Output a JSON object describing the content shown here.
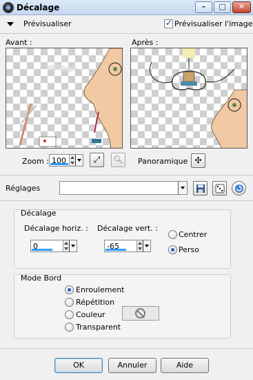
{
  "window": {
    "title": "Décalage"
  },
  "preview": {
    "toggle_label": "Prévisualiser",
    "live_label": "Prévisualiser l'image",
    "live_checked": true,
    "before_label": "Avant :",
    "after_label": "Après :"
  },
  "zoom": {
    "label": "Zoom :",
    "value": "100",
    "pan_label": "Panoramique :"
  },
  "presets": {
    "label": "Réglages",
    "value": ""
  },
  "offset": {
    "group_label": "Décalage",
    "h_label": "Décalage horiz. :",
    "h_value": "0",
    "v_label": "Décalage vert. :",
    "v_value": "-65",
    "center_label": "Centrer",
    "custom_label": "Perso",
    "selected": "custom"
  },
  "edge_mode": {
    "group_label": "Mode Bord",
    "options": [
      "Enroulement",
      "Répétition",
      "Couleur",
      "Transparent"
    ],
    "selected": "Enroulement"
  },
  "buttons": {
    "ok": "OK",
    "cancel": "Annuler",
    "help": "Aide"
  },
  "colors": {
    "accent": "#3399ff",
    "titlebar": "#c4d8f0",
    "close": "#c4472f"
  },
  "icons": {
    "app": "camera-lens-icon",
    "fit": "fit-window-icon",
    "zoom_to": "magnifier-icon",
    "pan": "move-cross-icon",
    "save": "floppy-save-icon",
    "random": "dice-icon",
    "reset": "reset-arrow-icon"
  }
}
